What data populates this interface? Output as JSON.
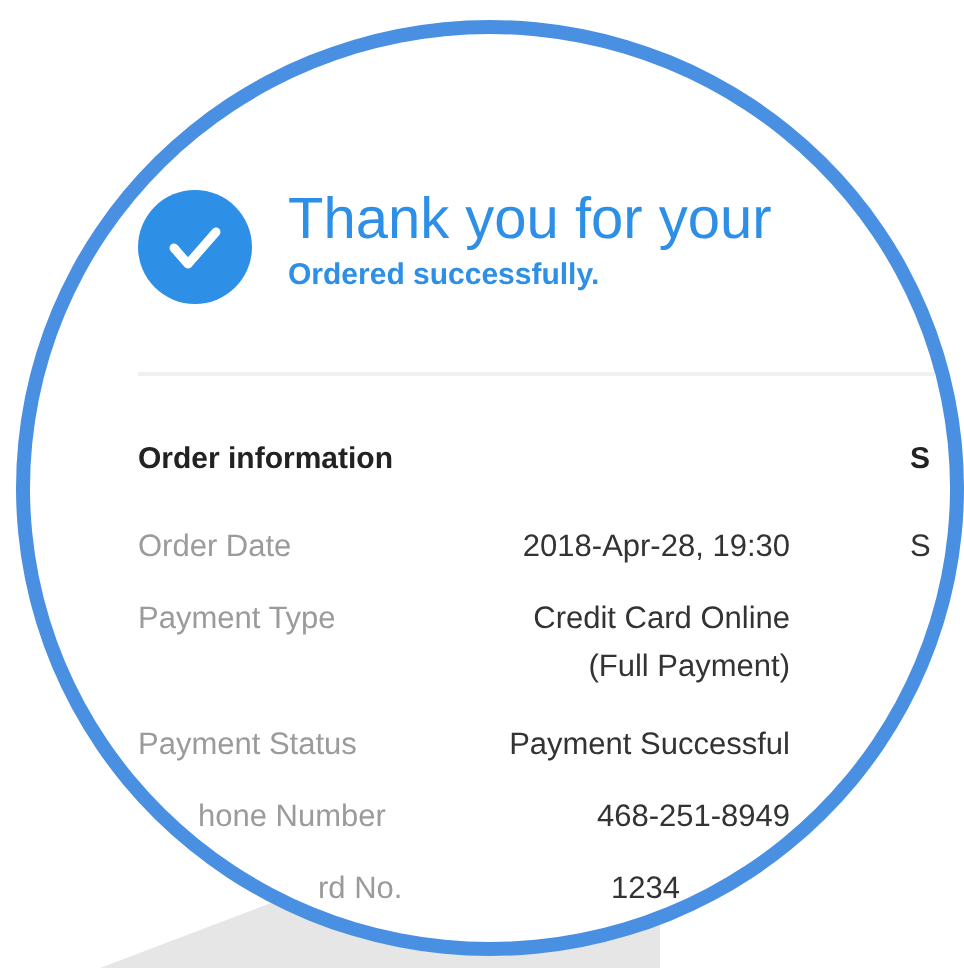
{
  "header": {
    "title": "Thank you for your",
    "subtitle": "Ordered successfully."
  },
  "order_information": {
    "heading": "Order information",
    "rows": [
      {
        "label": "Order Date",
        "value": "2018-Apr-28,  19:30"
      },
      {
        "label": "Payment Type",
        "value": "Credit Card Online\n(Full Payment)"
      },
      {
        "label": "Payment Status",
        "value": "Payment Successful"
      },
      {
        "label": "hone Number",
        "value": "468-251-8949"
      },
      {
        "label": "rd No.",
        "value": "1234"
      }
    ]
  },
  "side_column": {
    "heading": "S",
    "rows": [
      "S"
    ]
  }
}
